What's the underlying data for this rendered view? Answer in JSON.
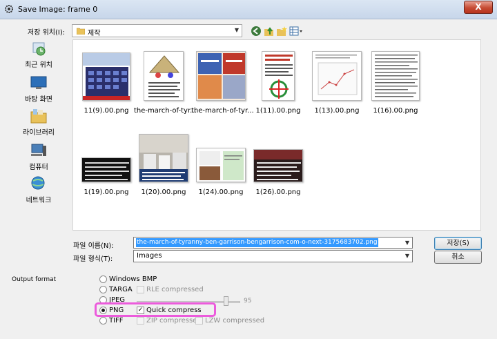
{
  "window": {
    "title": "Save Image: frame 0",
    "close_label": "X"
  },
  "lookin": {
    "label": "저장 위치(I):",
    "value": "제작"
  },
  "places": [
    {
      "label": "최근 위치",
      "icon": "recent-places-icon"
    },
    {
      "label": "바탕 화면",
      "icon": "desktop-icon"
    },
    {
      "label": "라이브러리",
      "icon": "libraries-icon"
    },
    {
      "label": "컴퓨터",
      "icon": "computer-icon"
    },
    {
      "label": "네트워크",
      "icon": "network-icon"
    }
  ],
  "files": [
    {
      "name": "11(9).00.png"
    },
    {
      "name": "the-march-of-tyr..."
    },
    {
      "name": "the-march-of-tyr..."
    },
    {
      "name": "1(11).00.png"
    },
    {
      "name": "1(13).00.png"
    },
    {
      "name": "1(16).00.png"
    },
    {
      "name": "1(19).00.png"
    },
    {
      "name": "1(20).00.png"
    },
    {
      "name": "1(24).00.png"
    },
    {
      "name": "1(26).00.png"
    }
  ],
  "filename": {
    "label": "파일 이름(N):",
    "value": "the-march-of-tyranny-ben-garrison-bengarrison-com-o-next-3175683702.png"
  },
  "filetype": {
    "label": "파일 형식(T):",
    "value": "Images"
  },
  "buttons": {
    "save": "저장(S)",
    "cancel": "취소"
  },
  "output_format": {
    "label": "Output format",
    "options": [
      {
        "label": "Windows BMP",
        "selected": false
      },
      {
        "label": "TARGA",
        "selected": false,
        "checkbox": "RLE compressed",
        "checkbox_enabled": false
      },
      {
        "label": "JPEG",
        "selected": false,
        "slider_value": "95"
      },
      {
        "label": "PNG",
        "selected": true,
        "checkbox": "Quick compress",
        "checkbox_enabled": true,
        "checked": true
      },
      {
        "label": "TIFF",
        "selected": false,
        "checkbox": "ZIP compressed",
        "checkbox2": "LZW compressed",
        "checkbox_enabled": false
      }
    ]
  },
  "colors": {
    "highlight": "#ec5bdc",
    "selection": "#3399ff",
    "close": "#c64b33"
  }
}
